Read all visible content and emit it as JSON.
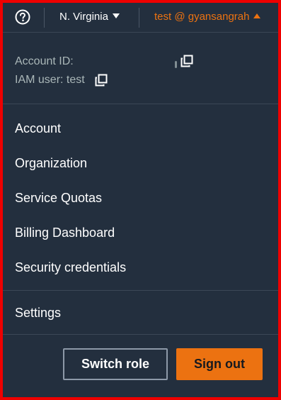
{
  "colors": {
    "background": "#232f3e",
    "accent": "#ec7211",
    "text": "#ffffff",
    "muted_text": "#aab7b8",
    "divider": "#3b4756",
    "outline": "#ee0000"
  },
  "topbar": {
    "help_icon": "help-circle-icon",
    "region": "N. Virginia",
    "user": "test @ gyansangrah"
  },
  "account": {
    "account_id_label": "Account ID:",
    "iam_user_label": "IAM user: test",
    "copy_icon": "copy-icon"
  },
  "menu": {
    "items": [
      {
        "label": "Account"
      },
      {
        "label": "Organization"
      },
      {
        "label": "Service Quotas"
      },
      {
        "label": "Billing Dashboard"
      },
      {
        "label": "Security credentials"
      }
    ],
    "settings": "Settings"
  },
  "actions": {
    "switch_role": "Switch role",
    "sign_out": "Sign out"
  }
}
